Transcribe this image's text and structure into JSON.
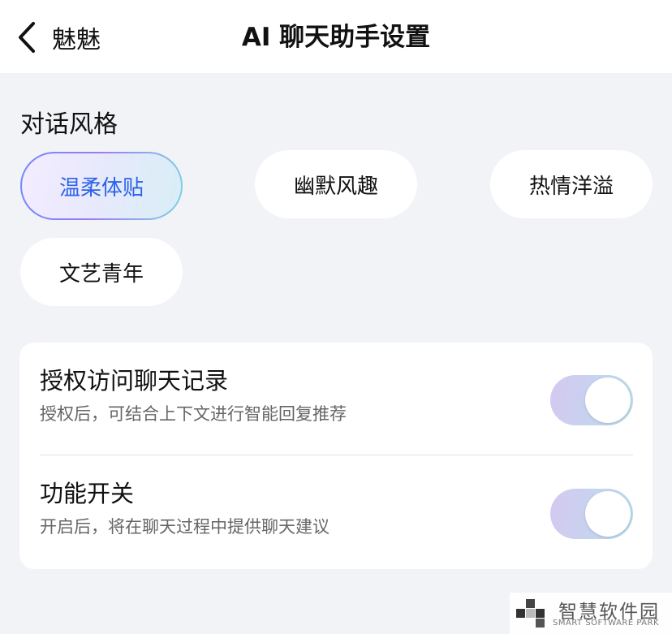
{
  "header": {
    "back_label": "魅魅",
    "title": "AI 聊天助手设置"
  },
  "style_section": {
    "title": "对话风格",
    "options": [
      {
        "label": "温柔体贴",
        "selected": true
      },
      {
        "label": "幽默风趣",
        "selected": false
      },
      {
        "label": "热情洋溢",
        "selected": false
      },
      {
        "label": "文艺青年",
        "selected": false
      }
    ]
  },
  "settings": [
    {
      "title": "授权访问聊天记录",
      "description": "授权后，可结合上下文进行智能回复推荐",
      "enabled": true
    },
    {
      "title": "功能开关",
      "description": "开启后，将在聊天过程中提供聊天建议",
      "enabled": true
    }
  ],
  "watermark": {
    "name": "智慧软件园",
    "subtitle": "SMART SOFTWARE PARK"
  },
  "colors": {
    "selected_text": "#2c63e8",
    "background": "#f2f3f7",
    "card": "#ffffff"
  },
  "icons": {
    "back": "chevron-left-icon"
  }
}
